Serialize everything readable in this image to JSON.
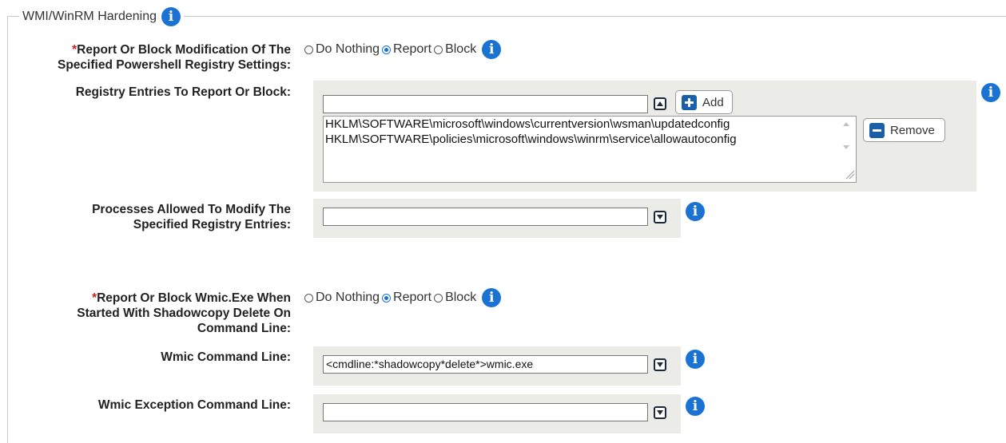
{
  "section": {
    "title": "WMI/WinRM Hardening",
    "info_icon": "info-icon"
  },
  "colors": {
    "accent": "#1a73d3",
    "required": "#d02020",
    "panel": "#ebebe8"
  },
  "ps_registry": {
    "label_required_mark": "*",
    "label_line1": "Report Or Block Modification Of The",
    "label_line2": "Specified Powershell Registry Settings:",
    "options": [
      "Do Nothing",
      "Report",
      "Block"
    ],
    "selected": "Report"
  },
  "registry_entries": {
    "label": "Registry Entries To Report Or Block:",
    "input_value": "",
    "add_label": "Add",
    "remove_label": "Remove",
    "items": [
      "HKLM\\SOFTWARE\\microsoft\\windows\\currentversion\\wsman\\updatedconfig",
      "HKLM\\SOFTWARE\\policies\\microsoft\\windows\\winrm\\service\\allowautoconfig"
    ]
  },
  "processes_allowed": {
    "label_line1": "Processes Allowed To Modify The",
    "label_line2": "Specified Registry Entries:",
    "input_value": ""
  },
  "wmic_shadowcopy": {
    "label_required_mark": "*",
    "label_line1": "Report Or Block Wmic.Exe When",
    "label_line2": "Started With Shadowcopy Delete On",
    "label_line3": "Command Line:",
    "options": [
      "Do Nothing",
      "Report",
      "Block"
    ],
    "selected": "Report"
  },
  "wmic_command_line": {
    "label": "Wmic Command Line:",
    "input_value": "<cmdline:*shadowcopy*delete*>wmic.exe"
  },
  "wmic_exception": {
    "label": "Wmic Exception Command Line:",
    "input_value": ""
  }
}
